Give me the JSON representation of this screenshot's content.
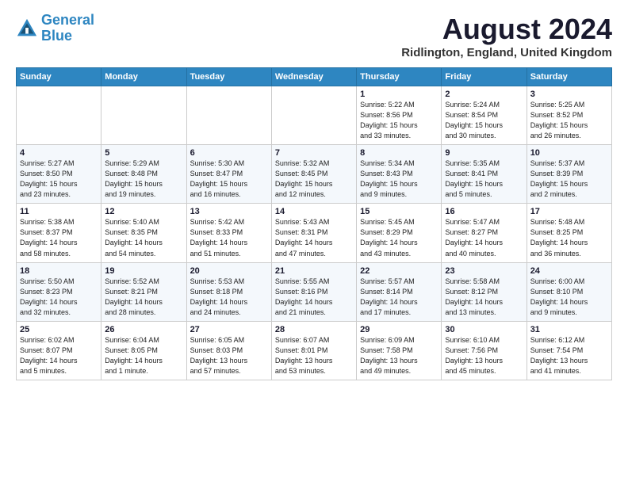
{
  "header": {
    "logo_line1": "General",
    "logo_line2": "Blue",
    "month_title": "August 2024",
    "location": "Ridlington, England, United Kingdom"
  },
  "weekdays": [
    "Sunday",
    "Monday",
    "Tuesday",
    "Wednesday",
    "Thursday",
    "Friday",
    "Saturday"
  ],
  "weeks": [
    [
      {
        "day": "",
        "info": ""
      },
      {
        "day": "",
        "info": ""
      },
      {
        "day": "",
        "info": ""
      },
      {
        "day": "",
        "info": ""
      },
      {
        "day": "1",
        "info": "Sunrise: 5:22 AM\nSunset: 8:56 PM\nDaylight: 15 hours\nand 33 minutes."
      },
      {
        "day": "2",
        "info": "Sunrise: 5:24 AM\nSunset: 8:54 PM\nDaylight: 15 hours\nand 30 minutes."
      },
      {
        "day": "3",
        "info": "Sunrise: 5:25 AM\nSunset: 8:52 PM\nDaylight: 15 hours\nand 26 minutes."
      }
    ],
    [
      {
        "day": "4",
        "info": "Sunrise: 5:27 AM\nSunset: 8:50 PM\nDaylight: 15 hours\nand 23 minutes."
      },
      {
        "day": "5",
        "info": "Sunrise: 5:29 AM\nSunset: 8:48 PM\nDaylight: 15 hours\nand 19 minutes."
      },
      {
        "day": "6",
        "info": "Sunrise: 5:30 AM\nSunset: 8:47 PM\nDaylight: 15 hours\nand 16 minutes."
      },
      {
        "day": "7",
        "info": "Sunrise: 5:32 AM\nSunset: 8:45 PM\nDaylight: 15 hours\nand 12 minutes."
      },
      {
        "day": "8",
        "info": "Sunrise: 5:34 AM\nSunset: 8:43 PM\nDaylight: 15 hours\nand 9 minutes."
      },
      {
        "day": "9",
        "info": "Sunrise: 5:35 AM\nSunset: 8:41 PM\nDaylight: 15 hours\nand 5 minutes."
      },
      {
        "day": "10",
        "info": "Sunrise: 5:37 AM\nSunset: 8:39 PM\nDaylight: 15 hours\nand 2 minutes."
      }
    ],
    [
      {
        "day": "11",
        "info": "Sunrise: 5:38 AM\nSunset: 8:37 PM\nDaylight: 14 hours\nand 58 minutes."
      },
      {
        "day": "12",
        "info": "Sunrise: 5:40 AM\nSunset: 8:35 PM\nDaylight: 14 hours\nand 54 minutes."
      },
      {
        "day": "13",
        "info": "Sunrise: 5:42 AM\nSunset: 8:33 PM\nDaylight: 14 hours\nand 51 minutes."
      },
      {
        "day": "14",
        "info": "Sunrise: 5:43 AM\nSunset: 8:31 PM\nDaylight: 14 hours\nand 47 minutes."
      },
      {
        "day": "15",
        "info": "Sunrise: 5:45 AM\nSunset: 8:29 PM\nDaylight: 14 hours\nand 43 minutes."
      },
      {
        "day": "16",
        "info": "Sunrise: 5:47 AM\nSunset: 8:27 PM\nDaylight: 14 hours\nand 40 minutes."
      },
      {
        "day": "17",
        "info": "Sunrise: 5:48 AM\nSunset: 8:25 PM\nDaylight: 14 hours\nand 36 minutes."
      }
    ],
    [
      {
        "day": "18",
        "info": "Sunrise: 5:50 AM\nSunset: 8:23 PM\nDaylight: 14 hours\nand 32 minutes."
      },
      {
        "day": "19",
        "info": "Sunrise: 5:52 AM\nSunset: 8:21 PM\nDaylight: 14 hours\nand 28 minutes."
      },
      {
        "day": "20",
        "info": "Sunrise: 5:53 AM\nSunset: 8:18 PM\nDaylight: 14 hours\nand 24 minutes."
      },
      {
        "day": "21",
        "info": "Sunrise: 5:55 AM\nSunset: 8:16 PM\nDaylight: 14 hours\nand 21 minutes."
      },
      {
        "day": "22",
        "info": "Sunrise: 5:57 AM\nSunset: 8:14 PM\nDaylight: 14 hours\nand 17 minutes."
      },
      {
        "day": "23",
        "info": "Sunrise: 5:58 AM\nSunset: 8:12 PM\nDaylight: 14 hours\nand 13 minutes."
      },
      {
        "day": "24",
        "info": "Sunrise: 6:00 AM\nSunset: 8:10 PM\nDaylight: 14 hours\nand 9 minutes."
      }
    ],
    [
      {
        "day": "25",
        "info": "Sunrise: 6:02 AM\nSunset: 8:07 PM\nDaylight: 14 hours\nand 5 minutes."
      },
      {
        "day": "26",
        "info": "Sunrise: 6:04 AM\nSunset: 8:05 PM\nDaylight: 14 hours\nand 1 minute."
      },
      {
        "day": "27",
        "info": "Sunrise: 6:05 AM\nSunset: 8:03 PM\nDaylight: 13 hours\nand 57 minutes."
      },
      {
        "day": "28",
        "info": "Sunrise: 6:07 AM\nSunset: 8:01 PM\nDaylight: 13 hours\nand 53 minutes."
      },
      {
        "day": "29",
        "info": "Sunrise: 6:09 AM\nSunset: 7:58 PM\nDaylight: 13 hours\nand 49 minutes."
      },
      {
        "day": "30",
        "info": "Sunrise: 6:10 AM\nSunset: 7:56 PM\nDaylight: 13 hours\nand 45 minutes."
      },
      {
        "day": "31",
        "info": "Sunrise: 6:12 AM\nSunset: 7:54 PM\nDaylight: 13 hours\nand 41 minutes."
      }
    ]
  ]
}
